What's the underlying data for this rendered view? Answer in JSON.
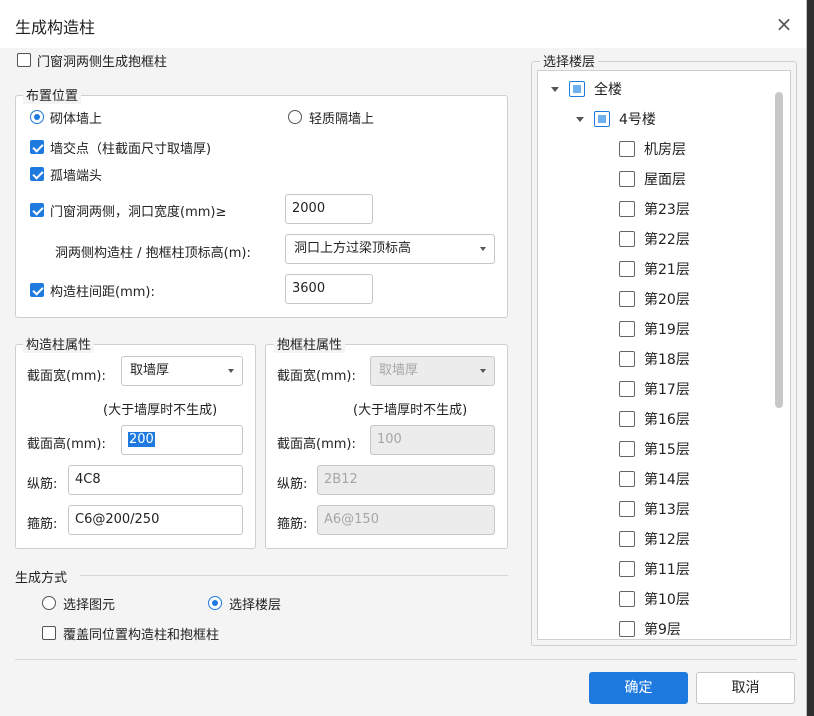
{
  "dialog": {
    "title": "生成构造柱",
    "close_icon": "×"
  },
  "top_option": {
    "label": "门窗洞两侧生成抱框柱",
    "checked": false
  },
  "placement": {
    "legend": "布置位置",
    "radio_masonry": {
      "label": "砌体墙上",
      "selected": true
    },
    "radio_light": {
      "label": "轻质隔墙上",
      "selected": false
    },
    "wall_junction": {
      "label": "墙交点（柱截面尺寸取墙厚)",
      "checked": true
    },
    "isolated_end": {
      "label": "孤墙端头",
      "checked": true
    },
    "opening_sides": {
      "label": "门窗洞两侧，洞口宽度(mm)≥",
      "checked": true,
      "value": "2000"
    },
    "top_elevation": {
      "label": "洞两侧构造柱 / 抱框柱顶标高(m):",
      "value": "洞口上方过梁顶标高"
    },
    "spacing": {
      "label": "构造柱间距(mm):",
      "checked": true,
      "value": "3600"
    }
  },
  "column_props": {
    "legend": "构造柱属性",
    "width_label": "截面宽(mm):",
    "width_value": "取墙厚",
    "note": "(大于墙厚时不生成)",
    "height_label": "截面高(mm):",
    "height_value": "200",
    "long_rebar_label": "纵筋:",
    "long_rebar_value": "4C8",
    "stirrup_label": "箍筋:",
    "stirrup_value": "C6@200/250"
  },
  "frame_props": {
    "legend": "抱框柱属性",
    "width_label": "截面宽(mm):",
    "width_value": "取墙厚",
    "note": "(大于墙厚时不生成)",
    "height_label": "截面高(mm):",
    "height_value": "100",
    "long_rebar_label": "纵筋:",
    "long_rebar_value": "2B12",
    "stirrup_label": "箍筋:",
    "stirrup_value": "A6@150"
  },
  "generate_mode": {
    "legend": "生成方式",
    "radio_element": {
      "label": "选择图元",
      "selected": false
    },
    "radio_floor": {
      "label": "选择楼层",
      "selected": true
    },
    "overwrite": {
      "label": "覆盖同位置构造柱和抱框柱",
      "checked": false
    }
  },
  "floors": {
    "legend": "选择楼层",
    "root": "全楼",
    "building": "4号楼",
    "items": [
      "机房层",
      "屋面层",
      "第23层",
      "第22层",
      "第21层",
      "第20层",
      "第19层",
      "第18层",
      "第17层",
      "第16层",
      "第15层",
      "第14层",
      "第13层",
      "第12层",
      "第11层",
      "第10层",
      "第9层"
    ]
  },
  "buttons": {
    "ok": "确定",
    "cancel": "取消"
  },
  "colors": {
    "accent": "#1f7ae0",
    "panel": "#f4f4f4",
    "disabled": "#ececec"
  }
}
